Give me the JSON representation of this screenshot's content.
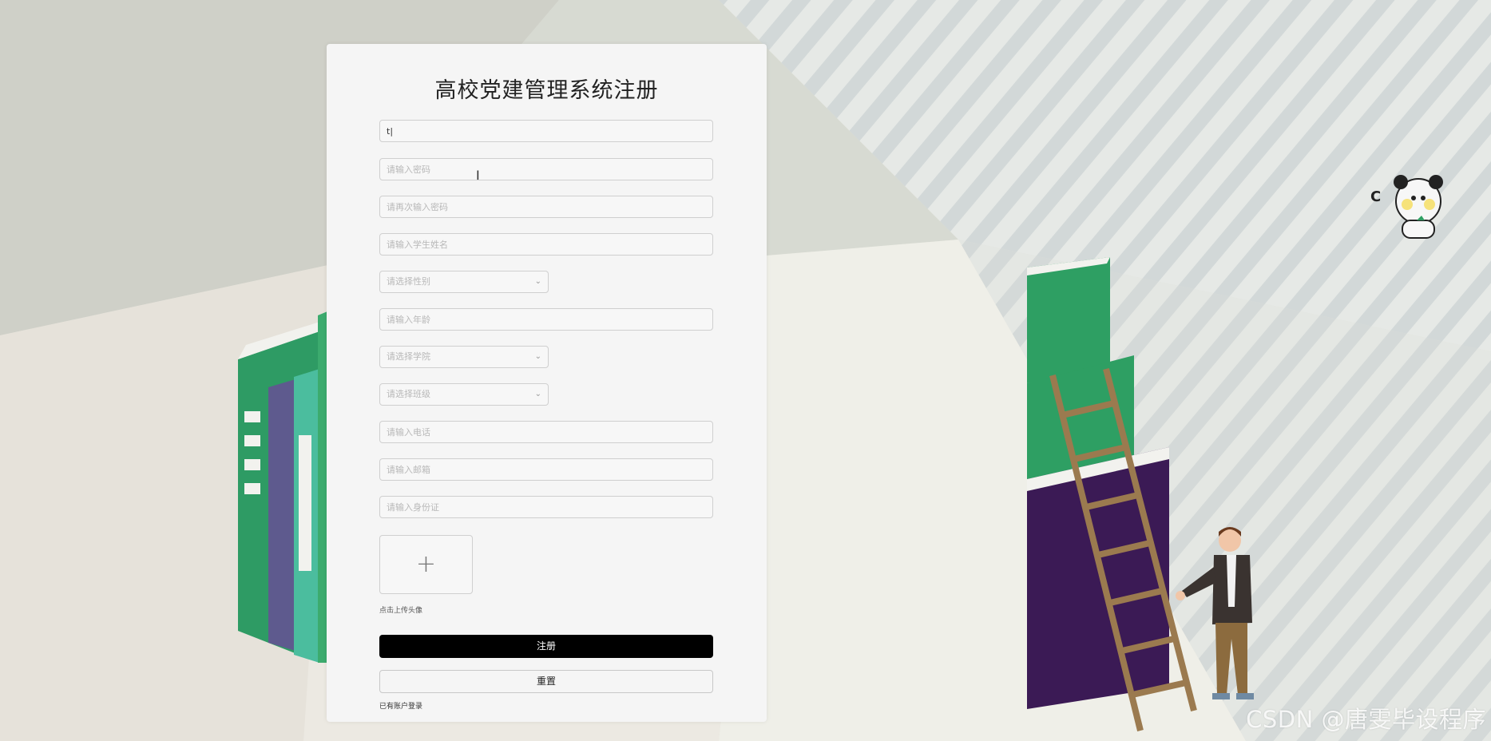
{
  "form": {
    "title": "高校党建管理系统注册",
    "account_value": "t|",
    "password_placeholder": "请输入密码",
    "confirm_password_placeholder": "请再次输入密码",
    "student_name_placeholder": "请输入学生姓名",
    "gender_placeholder": "请选择性别",
    "age_placeholder": "请输入年龄",
    "college_placeholder": "请选择学院",
    "class_placeholder": "请选择班级",
    "phone_placeholder": "请输入电话",
    "email_placeholder": "请输入邮箱",
    "id_card_placeholder": "请输入身份证",
    "upload_plus": "+",
    "upload_hint": "点击上传头像",
    "submit_label": "注册",
    "reset_label": "重置",
    "login_link": "已有账户登录"
  },
  "watermark": "CSDN @唐雯毕设程序",
  "icons": {
    "chevron": "chevron-down-icon",
    "cursor": "text-cursor-icon"
  },
  "colors": {
    "submit_bg": "#000000",
    "book_green": "#2ea265",
    "book_purple": "#3b1a55"
  }
}
